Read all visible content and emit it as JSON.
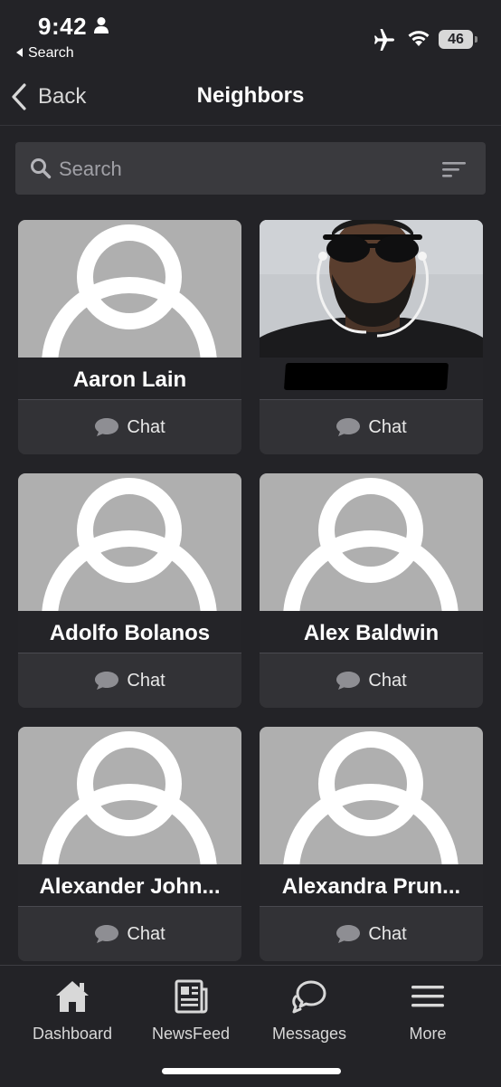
{
  "status_bar": {
    "time": "9:42",
    "back_app": "Search",
    "battery": "46"
  },
  "navbar": {
    "back_label": "Back",
    "title": "Neighbors"
  },
  "search": {
    "placeholder": "Search"
  },
  "neighbors": [
    {
      "name": "Aaron Lain",
      "chat_label": "Chat"
    },
    {
      "name": "",
      "chat_label": "Chat"
    },
    {
      "name": "Adolfo Bolanos",
      "chat_label": "Chat"
    },
    {
      "name": "Alex Baldwin",
      "chat_label": "Chat"
    },
    {
      "name": "Alexander John...",
      "chat_label": "Chat"
    },
    {
      "name": "Alexandra Prun...",
      "chat_label": "Chat"
    }
  ],
  "tabs": [
    {
      "label": "Dashboard",
      "icon": "home-icon"
    },
    {
      "label": "NewsFeed",
      "icon": "newspaper-icon"
    },
    {
      "label": "Messages",
      "icon": "chat-bubbles-icon"
    },
    {
      "label": "More",
      "icon": "hamburger-menu-icon"
    }
  ]
}
